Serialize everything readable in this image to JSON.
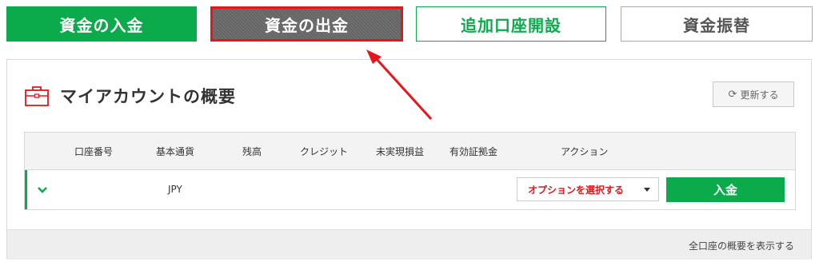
{
  "top_actions": {
    "deposit": "資金の入金",
    "withdraw": "資金の出金",
    "add_account": "追加口座開設",
    "transfer": "資金振替"
  },
  "panel": {
    "title": "マイアカウントの概要",
    "refresh_label": "更新する"
  },
  "table": {
    "headers": [
      "口座番号",
      "基本通貨",
      "残高",
      "クレジット",
      "未実現損益",
      "有効証拠金",
      "アクション"
    ],
    "rows": [
      {
        "currency": "JPY",
        "action_select": "オプションを選択する",
        "deposit_label": "入金"
      }
    ]
  },
  "footer": {
    "show_all_label": "全口座の概要を表示する"
  },
  "colors": {
    "accent_green": "#0bab4c",
    "highlight_red": "#e3161b",
    "withdraw_gray": "#666666"
  },
  "icons": [
    "briefcase-icon",
    "refresh-icon",
    "chevron-down-icon",
    "caret-down-icon",
    "annotation-arrow"
  ]
}
